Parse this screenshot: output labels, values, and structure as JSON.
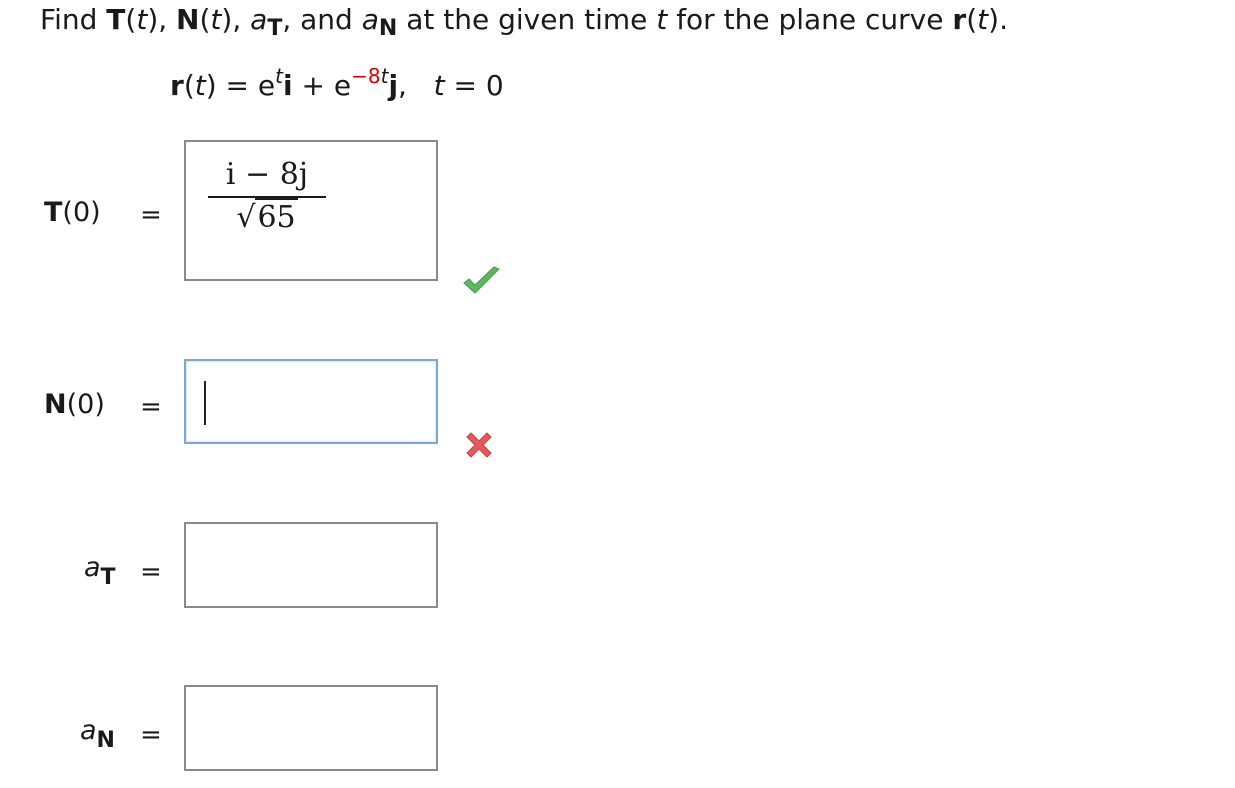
{
  "question": {
    "find": "Find",
    "T": "T",
    "t_paren_open": "(",
    "t_var": "t",
    "t_paren_close_comma": "),",
    "N": "N",
    "a": "a",
    "T_sub": "T",
    "comma": ",",
    "and": "and",
    "N_sub": "N",
    "rest": "at the given time",
    "for_the": "for the plane curve",
    "r": "r",
    "period": "."
  },
  "formula": {
    "r": "r",
    "open": "(",
    "t": "t",
    "close_eq": ") = e",
    "exp1": "t",
    "i": "i",
    "plus_e": " + e",
    "exp2_neg": "−8",
    "exp2_t": "t",
    "j": "j",
    "comma": ",",
    "t_eq": "t",
    "t_value": " = 0"
  },
  "answers": [
    {
      "label_main": "T",
      "label_arg": "(0)",
      "equals": "=",
      "numerator": "i − 8j",
      "sqrt_symbol": "√",
      "radicand": "65",
      "status": "correct",
      "status_color": "#5cb85c"
    },
    {
      "label_main": "N",
      "label_arg": "(0)",
      "equals": "=",
      "value": "",
      "status": "incorrect",
      "status_color": "#e8575a"
    },
    {
      "label_main": "a",
      "label_sub": "T",
      "equals": "=",
      "value": ""
    },
    {
      "label_main": "a",
      "label_sub": "N",
      "equals": "=",
      "value": ""
    }
  ]
}
